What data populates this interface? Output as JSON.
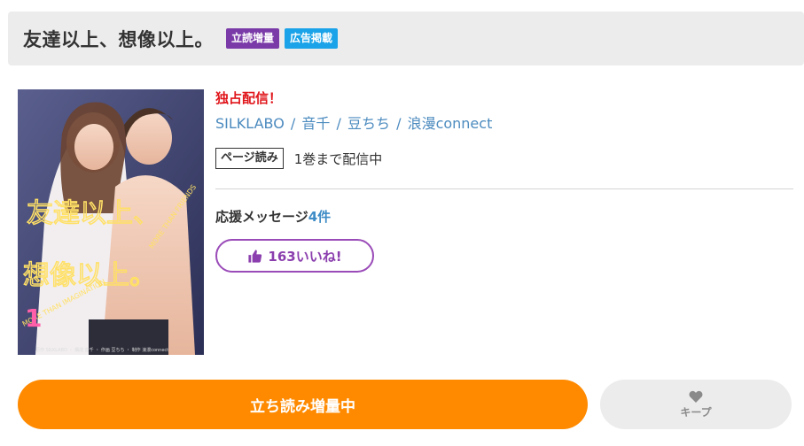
{
  "header": {
    "title": "友達以上、想像以上。",
    "tags": [
      "立読増量",
      "広告掲載"
    ]
  },
  "cover": {
    "title_jp": "友達以上、想像以上。",
    "subtitle_en_1": "MORE THAN FRIENDS",
    "subtitle_en_2": "MORE THAN IMAGINATION",
    "volume": "1",
    "credits": "原作 SILKLABO ・ 構成 音千 ・ 作画 豆ちち ・ 制作 浪漫connect"
  },
  "info": {
    "exclusive": "独占配信！",
    "authors": [
      "SILKLABO",
      "音千",
      "豆ちち",
      "浪漫connect"
    ],
    "separator": "/",
    "page_badge": "ページ読み",
    "page_status": "1巻まで配信中",
    "support_label": "応援メッセージ",
    "support_count": "4件",
    "like_label": "163いいね!"
  },
  "actions": {
    "read_label": "立ち読み増量中",
    "keep_label": "キープ"
  },
  "colors": {
    "accent_orange": "#ff8a00",
    "tag_purple": "#7a3ba8",
    "tag_blue": "#1aa3e8",
    "exclusive_red": "#e0161b",
    "author_blue": "#4c8bbf",
    "like_purple": "#9a4bb8"
  },
  "icons": {
    "like": "thumbs-up-icon",
    "keep": "heart-icon"
  }
}
